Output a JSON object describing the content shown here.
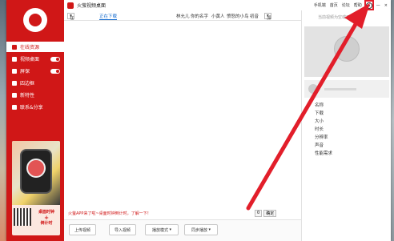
{
  "app": {
    "title": "火萤视频桌面"
  },
  "header": {
    "links": [
      "手机端",
      "首页",
      "论坛",
      "帮助"
    ],
    "settings": "settings",
    "min": "—",
    "close": "×"
  },
  "sidebar": {
    "items": [
      {
        "label": "在线资源",
        "active": true
      },
      {
        "label": "视频桌面",
        "toggle": true
      },
      {
        "label": "屏保",
        "toggle": true
      },
      {
        "label": "四边框"
      },
      {
        "label": "新特性"
      },
      {
        "label": "联系&分享"
      }
    ],
    "ad": {
      "line1": "桌面时钟",
      "line2": "倒计时"
    }
  },
  "tabs": {
    "online": "在线资源",
    "downloading": "正在下载",
    "filters": [
      "林允儿",
      "你的名字",
      "小黄人",
      "愤怒的小鸟",
      "初音"
    ],
    "sort": "加入时间"
  },
  "content": {
    "tip": "火萤APP来了啦~桌面时钟倒计时，了解一下！",
    "page": "0",
    "go": "确定"
  },
  "toolbar": {
    "upload": "上传视频",
    "import": "导入视频",
    "play_mode": "播放模式",
    "play": "同步播放"
  },
  "right_panel": {
    "hint": "当前视频为空或不可用",
    "props": [
      "名称",
      "下载",
      "大小",
      "时长",
      "分辨率",
      "声音",
      "性能需求"
    ]
  },
  "colors": {
    "brand": "#d01717",
    "highlight": "#e21e2a"
  }
}
